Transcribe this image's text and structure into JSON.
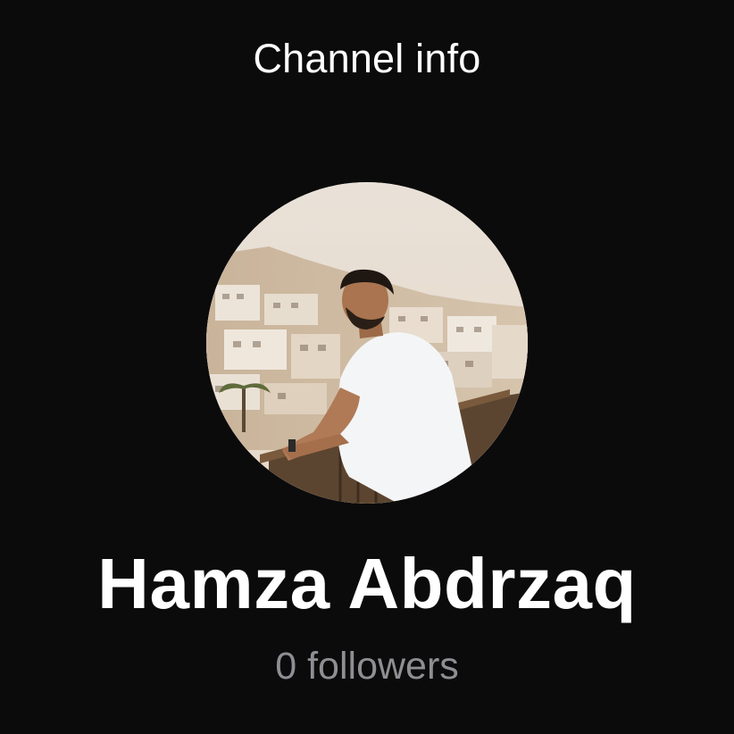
{
  "header": {
    "title": "Channel info"
  },
  "channel": {
    "name": "Hamza Abdrzaq",
    "followers": "0 followers"
  },
  "avatar": {
    "icon": "profile-photo"
  },
  "colors": {
    "background": "#0b0b0c",
    "primary_text": "#ffffff",
    "secondary_text": "#8e8e93"
  }
}
